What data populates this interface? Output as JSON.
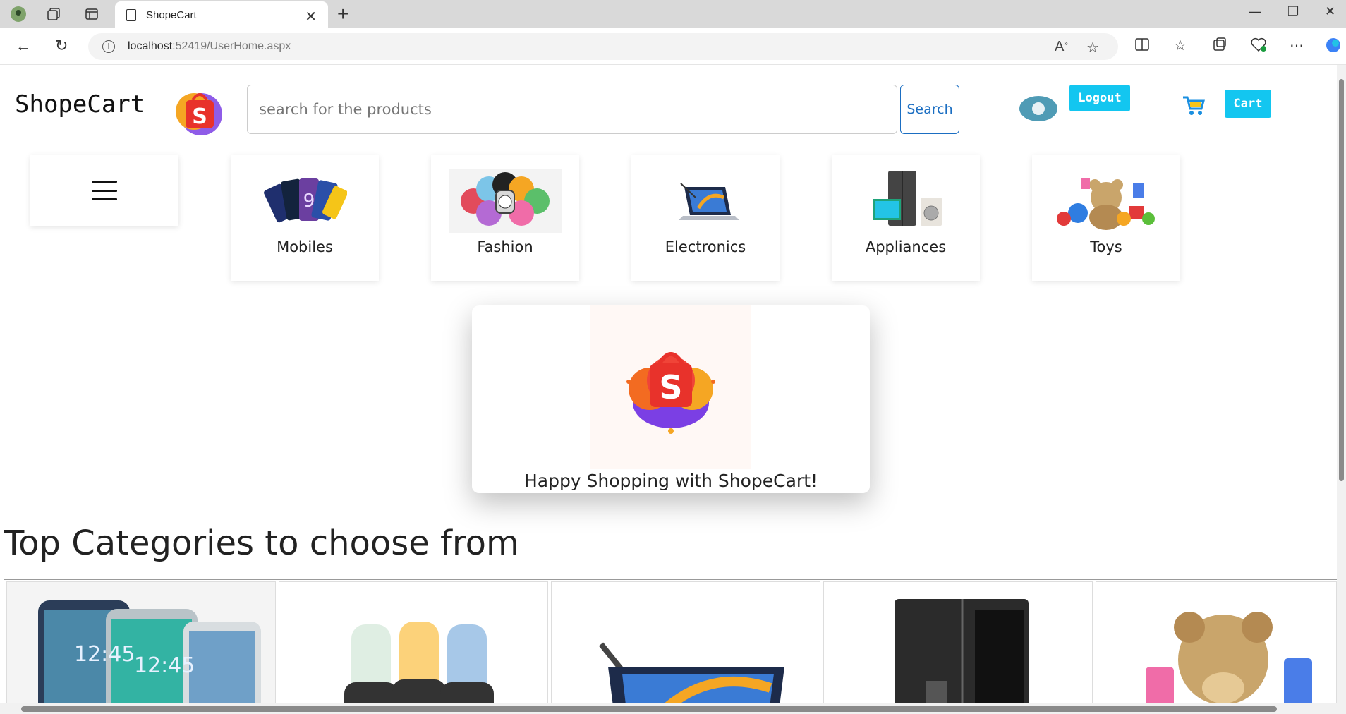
{
  "browser": {
    "tab_title": "ShopeCart",
    "url_host": "localhost",
    "url_path": ":52419/UserHome.aspx"
  },
  "header": {
    "brand": "ShopeCart",
    "search_placeholder": "search for the products",
    "search_button": "Search",
    "logout_button": "Logout",
    "cart_button": "Cart"
  },
  "categories": [
    {
      "label": "Mobiles",
      "icon": "smartphones-image"
    },
    {
      "label": "Fashion",
      "icon": "smartwatches-image"
    },
    {
      "label": "Electronics",
      "icon": "laptop-image"
    },
    {
      "label": "Appliances",
      "icon": "refrigerator-image"
    },
    {
      "label": "Toys",
      "icon": "teddy-bear-image"
    }
  ],
  "hero": {
    "caption": "Happy Shopping with ShopeCart!"
  },
  "section": {
    "title": "Top Categories to choose from"
  },
  "colors": {
    "accent": "#13c6f0",
    "link_blue": "#1b6ec2"
  }
}
